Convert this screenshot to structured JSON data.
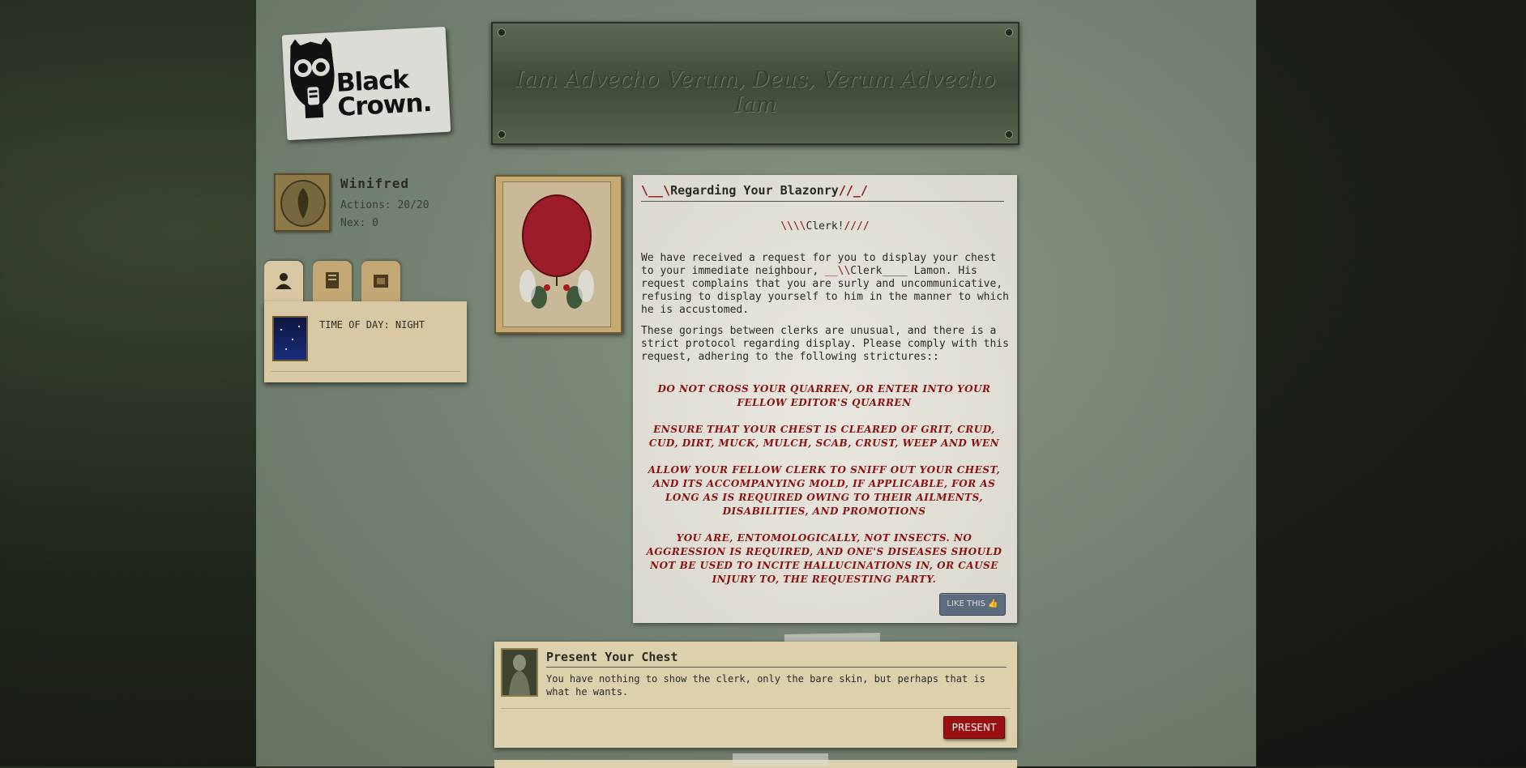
{
  "logo": {
    "line1": "Black",
    "line2": "Crown."
  },
  "banner": {
    "motto": "Iam Advecho Verum, Deus, Verum Advecho Iam"
  },
  "profile": {
    "name": "Winifred",
    "actions_label": "Actions: 20/20",
    "nex_label": "Nex: 0"
  },
  "tabs": [
    {
      "icon": "person-icon"
    },
    {
      "icon": "notebook-icon"
    },
    {
      "icon": "box-icon"
    }
  ],
  "side": {
    "time_of_day": "TIME OF DAY: NIGHT"
  },
  "storylet": {
    "title_prefix": "\\__\\",
    "title": "Regarding Your Blazonry",
    "title_suffix": "//_/",
    "clerk_prefix": "\\\\\\\\",
    "clerk_word": "Clerk!",
    "clerk_suffix": "////",
    "para1_a": "We have received a request for you to display your chest to your immediate neighbour, ",
    "para1_prefix": "__\\\\",
    "para1_clerk": "Clerk____",
    "para1_b": " Lamon. His request complains that you are surly and uncommunicative, refusing to display yourself to him in the manner to which he is accustomed.",
    "para2": "These gorings between clerks are unusual, and there is a strict protocol regarding display. Please comply with this request, adhering to the following strictures::",
    "strictures": [
      "DO NOT CROSS YOUR QUARREN, OR ENTER INTO YOUR FELLOW EDITOR'S QUARREN",
      "ENSURE THAT YOUR CHEST IS CLEARED OF GRIT, CRUD, CUD, DIRT, MUCK, MULCH, SCAB, CRUST, WEEP AND WEN",
      "ALLOW YOUR FELLOW CLERK TO SNIFF OUT YOUR CHEST, AND ITS ACCOMPANYING MOLD, IF APPLICABLE, FOR AS LONG AS IS REQUIRED OWING TO THEIR AILMENTS, DISABILITIES, AND PROMOTIONS",
      "YOU ARE, ENTOMOLOGICALLY, NOT INSECTS. NO AGGRESSION IS REQUIRED, AND ONE'S DISEASES SHOULD NOT BE USED TO INCITE HALLUCINATIONS IN, OR CAUSE INJURY TO, THE REQUESTING PARTY."
    ],
    "like_label": "LIKE THIS"
  },
  "action": {
    "title": "Present Your Chest",
    "description": "You have nothing to show the clerk, only the bare skin, but perhaps that is what he wants.",
    "button_label": "PRESENT"
  },
  "colors": {
    "accent_red": "#8d1515",
    "button_red": "#9a0f0f",
    "like_button": "#5c6b7d"
  }
}
